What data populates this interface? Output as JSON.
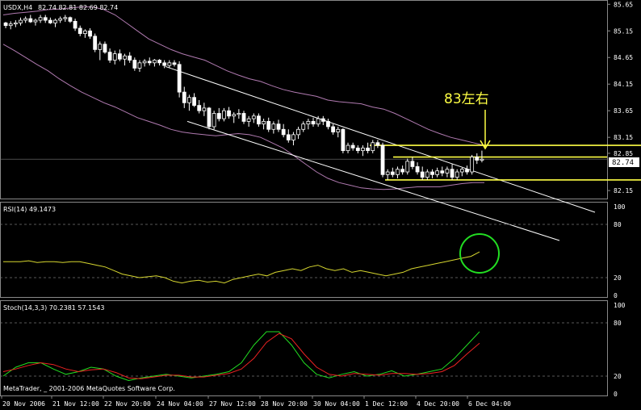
{
  "main": {
    "symbol": "USDX,H4",
    "ohlc": "82.74 82.81 82.69 82.74",
    "price_levels": [
      "85.65",
      "85.15",
      "84.65",
      "84.15",
      "83.65",
      "83.15",
      "82.85",
      "82.15"
    ],
    "current_price": "82.74",
    "annotation": "83左右"
  },
  "rsi": {
    "title": "RSI(14) 49.1473",
    "levels": [
      "100",
      "80",
      "20",
      "0"
    ]
  },
  "stoch": {
    "title": "Stoch(14,3,3) 70.2381 57.1543",
    "levels": [
      "100",
      "80",
      "20",
      "0"
    ],
    "copyright": "MetaTrader, _ 2001-2006 MetaQuotes Software Corp."
  },
  "x_axis": {
    "labels": [
      "20 Nov 2006",
      "21 Nov 12:00",
      "22 Nov 20:00",
      "24 Nov 04:00",
      "27 Nov 12:00",
      "28 Nov 20:00",
      "30 Nov 04:00",
      "1 Dec 12:00",
      "4 Dec 20:00",
      "6 Dec 04:00"
    ]
  },
  "colors": {
    "background": "#000000",
    "grid": "#777777",
    "candle": "#ffffff",
    "bands": "#b07ab0",
    "channel": "#ffffff",
    "annotation": "#ffff44",
    "rsi": "#d6d62f",
    "stoch_main": "#22dd22",
    "stoch_signal": "#ee2222",
    "highlight_circle": "#22dd22"
  },
  "chart_data": [
    {
      "type": "candlestick",
      "title": "USDX,H4 82.74 82.81 82.69 82.74",
      "y_ticks": [
        85.65,
        85.15,
        84.65,
        84.15,
        83.65,
        83.15,
        82.85,
        82.15
      ],
      "ylim": [
        82.0,
        85.7
      ],
      "x_labels": [
        "20 Nov 2006",
        "21 Nov 12:00",
        "22 Nov 20:00",
        "24 Nov 04:00",
        "27 Nov 12:00",
        "28 Nov 20:00",
        "30 Nov 04:00",
        "1 Dec 12:00",
        "4 Dec 20:00",
        "6 Dec 04:00"
      ],
      "ohlc": [
        [
          85.3,
          85.32,
          85.2,
          85.25
        ],
        [
          85.25,
          85.33,
          85.18,
          85.28
        ],
        [
          85.28,
          85.35,
          85.22,
          85.3
        ],
        [
          85.3,
          85.4,
          85.25,
          85.35
        ],
        [
          85.35,
          85.42,
          85.3,
          85.38
        ],
        [
          85.38,
          85.45,
          85.3,
          85.32
        ],
        [
          85.32,
          85.38,
          85.25,
          85.35
        ],
        [
          85.35,
          85.45,
          85.3,
          85.4
        ],
        [
          85.4,
          85.45,
          85.3,
          85.35
        ],
        [
          85.35,
          85.4,
          85.28,
          85.3
        ],
        [
          85.3,
          85.38,
          85.22,
          85.35
        ],
        [
          85.35,
          85.42,
          85.3,
          85.38
        ],
        [
          85.38,
          85.45,
          85.32,
          85.4
        ],
        [
          85.4,
          85.42,
          85.3,
          85.33
        ],
        [
          85.33,
          85.38,
          85.15,
          85.2
        ],
        [
          85.2,
          85.25,
          85.05,
          85.1
        ],
        [
          85.1,
          85.18,
          85.02,
          85.15
        ],
        [
          85.15,
          85.2,
          85.0,
          85.05
        ],
        [
          85.05,
          85.1,
          84.75,
          84.8
        ],
        [
          84.8,
          84.95,
          84.6,
          84.9
        ],
        [
          84.9,
          84.95,
          84.72,
          84.75
        ],
        [
          84.75,
          84.82,
          84.55,
          84.6
        ],
        [
          84.6,
          84.78,
          84.52,
          84.72
        ],
        [
          84.72,
          84.8,
          84.58,
          84.62
        ],
        [
          84.62,
          84.72,
          84.5,
          84.68
        ],
        [
          84.68,
          84.75,
          84.55,
          84.6
        ],
        [
          84.6,
          84.65,
          84.4,
          84.45
        ],
        [
          84.45,
          84.6,
          84.38,
          84.55
        ],
        [
          84.55,
          84.62,
          84.48,
          84.58
        ],
        [
          84.58,
          84.65,
          84.5,
          84.55
        ],
        [
          84.55,
          84.62,
          84.48,
          84.6
        ],
        [
          84.6,
          84.62,
          84.5,
          84.55
        ],
        [
          84.55,
          84.6,
          84.45,
          84.5
        ],
        [
          84.5,
          84.6,
          84.45,
          84.55
        ],
        [
          84.55,
          84.6,
          84.48,
          84.52
        ],
        [
          84.52,
          84.58,
          83.9,
          84.0
        ],
        [
          84.0,
          84.1,
          83.7,
          83.8
        ],
        [
          83.8,
          83.95,
          83.65,
          83.9
        ],
        [
          83.9,
          83.98,
          83.72,
          83.75
        ],
        [
          83.75,
          83.85,
          83.6,
          83.65
        ],
        [
          83.65,
          83.8,
          83.55,
          83.7
        ],
        [
          83.7,
          83.72,
          83.3,
          83.35
        ],
        [
          83.35,
          83.65,
          83.3,
          83.6
        ],
        [
          83.6,
          83.7,
          83.45,
          83.5
        ],
        [
          83.5,
          83.7,
          83.45,
          83.65
        ],
        [
          83.65,
          83.72,
          83.5,
          83.55
        ],
        [
          83.55,
          83.62,
          83.42,
          83.58
        ],
        [
          83.58,
          83.68,
          83.5,
          83.6
        ],
        [
          83.6,
          83.65,
          83.4,
          83.45
        ],
        [
          83.45,
          83.55,
          83.35,
          83.5
        ],
        [
          83.5,
          83.6,
          83.42,
          83.55
        ],
        [
          83.55,
          83.6,
          83.35,
          83.4
        ],
        [
          83.4,
          83.5,
          83.3,
          83.45
        ],
        [
          83.45,
          83.52,
          83.25,
          83.3
        ],
        [
          83.3,
          83.45,
          83.22,
          83.4
        ],
        [
          83.4,
          83.48,
          83.25,
          83.3
        ],
        [
          83.3,
          83.4,
          83.15,
          83.2
        ],
        [
          83.2,
          83.3,
          83.05,
          83.1
        ],
        [
          83.1,
          83.25,
          83.0,
          83.2
        ],
        [
          83.2,
          83.35,
          83.12,
          83.3
        ],
        [
          83.3,
          83.45,
          83.25,
          83.4
        ],
        [
          83.4,
          83.5,
          83.3,
          83.45
        ],
        [
          83.45,
          83.52,
          83.35,
          83.4
        ],
        [
          83.4,
          83.55,
          83.35,
          83.5
        ],
        [
          83.5,
          83.55,
          83.38,
          83.45
        ],
        [
          83.45,
          83.5,
          83.3,
          83.35
        ],
        [
          83.35,
          83.4,
          83.2,
          83.25
        ],
        [
          83.25,
          83.35,
          83.15,
          83.3
        ],
        [
          83.3,
          83.32,
          82.85,
          82.9
        ],
        [
          82.9,
          83.05,
          82.85,
          83.0
        ],
        [
          83.0,
          83.05,
          82.9,
          82.95
        ],
        [
          82.95,
          83.0,
          82.85,
          82.9
        ],
        [
          82.9,
          83.0,
          82.8,
          82.95
        ],
        [
          82.95,
          83.05,
          82.85,
          82.9
        ],
        [
          82.9,
          83.1,
          82.85,
          83.05
        ],
        [
          83.05,
          83.1,
          82.95,
          83.0
        ],
        [
          83.0,
          83.05,
          82.4,
          82.45
        ],
        [
          82.45,
          82.55,
          82.35,
          82.5
        ],
        [
          82.5,
          82.58,
          82.4,
          82.45
        ],
        [
          82.45,
          82.6,
          82.38,
          82.55
        ],
        [
          82.55,
          82.62,
          82.45,
          82.5
        ],
        [
          82.5,
          82.75,
          82.45,
          82.7
        ],
        [
          82.7,
          82.78,
          82.55,
          82.6
        ],
        [
          82.6,
          82.68,
          82.45,
          82.5
        ],
        [
          82.5,
          82.6,
          82.35,
          82.4
        ],
        [
          82.4,
          82.55,
          82.35,
          82.5
        ],
        [
          82.5,
          82.55,
          82.38,
          82.45
        ],
        [
          82.45,
          82.58,
          82.4,
          82.52
        ],
        [
          82.52,
          82.6,
          82.42,
          82.48
        ],
        [
          82.48,
          82.6,
          82.4,
          82.55
        ],
        [
          82.55,
          82.65,
          82.35,
          82.4
        ],
        [
          82.4,
          82.55,
          82.35,
          82.5
        ],
        [
          82.5,
          82.58,
          82.42,
          82.55
        ],
        [
          82.55,
          82.62,
          82.45,
          82.5
        ],
        [
          82.5,
          82.82,
          82.45,
          82.78
        ],
        [
          82.78,
          82.85,
          82.65,
          82.72
        ],
        [
          82.72,
          82.9,
          82.68,
          82.74
        ]
      ],
      "bollinger_upper": [
        85.45,
        85.48,
        85.5,
        85.52,
        85.55,
        85.56,
        85.58,
        85.6,
        85.6,
        85.55,
        85.45,
        85.3,
        85.15,
        85.0,
        84.9,
        84.8,
        84.72,
        84.66,
        84.6,
        84.5,
        84.4,
        84.32,
        84.25,
        84.2,
        84.12,
        84.05,
        84.0,
        83.96,
        83.92,
        83.85,
        83.82,
        83.8,
        83.78,
        83.72,
        83.68,
        83.6,
        83.5,
        83.4,
        83.3,
        83.22,
        83.15,
        83.1,
        83.05,
        83.0
      ],
      "bollinger_lower": [
        84.9,
        84.78,
        84.65,
        84.52,
        84.4,
        84.25,
        84.12,
        84.0,
        83.9,
        83.8,
        83.72,
        83.62,
        83.52,
        83.45,
        83.38,
        83.3,
        83.25,
        83.22,
        83.2,
        83.18,
        83.2,
        83.22,
        83.2,
        83.15,
        83.05,
        82.95,
        82.8,
        82.65,
        82.5,
        82.38,
        82.3,
        82.25,
        82.2,
        82.18,
        82.17,
        82.18,
        82.2,
        82.22,
        82.22,
        82.22,
        82.25,
        82.28,
        82.3,
        82.3
      ],
      "channel_lines": [
        {
          "from": [
            84.48,
            0.395
          ],
          "to": [
            82.05,
            1.0
          ]
        },
        {
          "from": [
            83.45,
            0.395
          ],
          "to": [
            82.0,
            1.0
          ]
        }
      ],
      "horizontal_lines": [
        83.0,
        82.78,
        82.35
      ],
      "annotation": {
        "text": "83左右",
        "target": 83.0
      }
    },
    {
      "type": "line",
      "title": "RSI(14) 49.1473",
      "ylim": [
        0,
        100
      ],
      "y_ticks": [
        100,
        80,
        20,
        0
      ],
      "series": [
        {
          "values": [
            38,
            38,
            38,
            39,
            37,
            38,
            38,
            37,
            38,
            38,
            36,
            34,
            32,
            28,
            24,
            22,
            20,
            21,
            22,
            20,
            16,
            14,
            16,
            17,
            15,
            16,
            14,
            18,
            20,
            22,
            24,
            22,
            26,
            28,
            30,
            28,
            32,
            34,
            30,
            28,
            30,
            26,
            28,
            26,
            24,
            22,
            24,
            26,
            30,
            32,
            34,
            36,
            38,
            40,
            42,
            44,
            49
          ]
        }
      ]
    },
    {
      "type": "line",
      "title": "Stoch(14,3,3) 70.2381 57.1543",
      "ylim": [
        0,
        100
      ],
      "y_ticks": [
        100,
        80,
        20,
        0
      ],
      "series": [
        {
          "values": [
            20,
            30,
            35,
            35,
            28,
            22,
            25,
            30,
            28,
            20,
            15,
            18,
            20,
            22,
            20,
            18,
            20,
            22,
            25,
            35,
            55,
            70,
            70,
            55,
            35,
            22,
            18,
            22,
            25,
            20,
            22,
            26,
            20,
            22,
            25,
            28,
            40,
            55,
            70
          ]
        },
        {
          "values": [
            25,
            28,
            32,
            35,
            33,
            28,
            25,
            27,
            28,
            24,
            18,
            17,
            19,
            21,
            21,
            19,
            19,
            21,
            23,
            28,
            40,
            58,
            68,
            62,
            45,
            30,
            22,
            20,
            23,
            22,
            21,
            23,
            23,
            22,
            23,
            25,
            32,
            45,
            57
          ]
        }
      ]
    }
  ]
}
